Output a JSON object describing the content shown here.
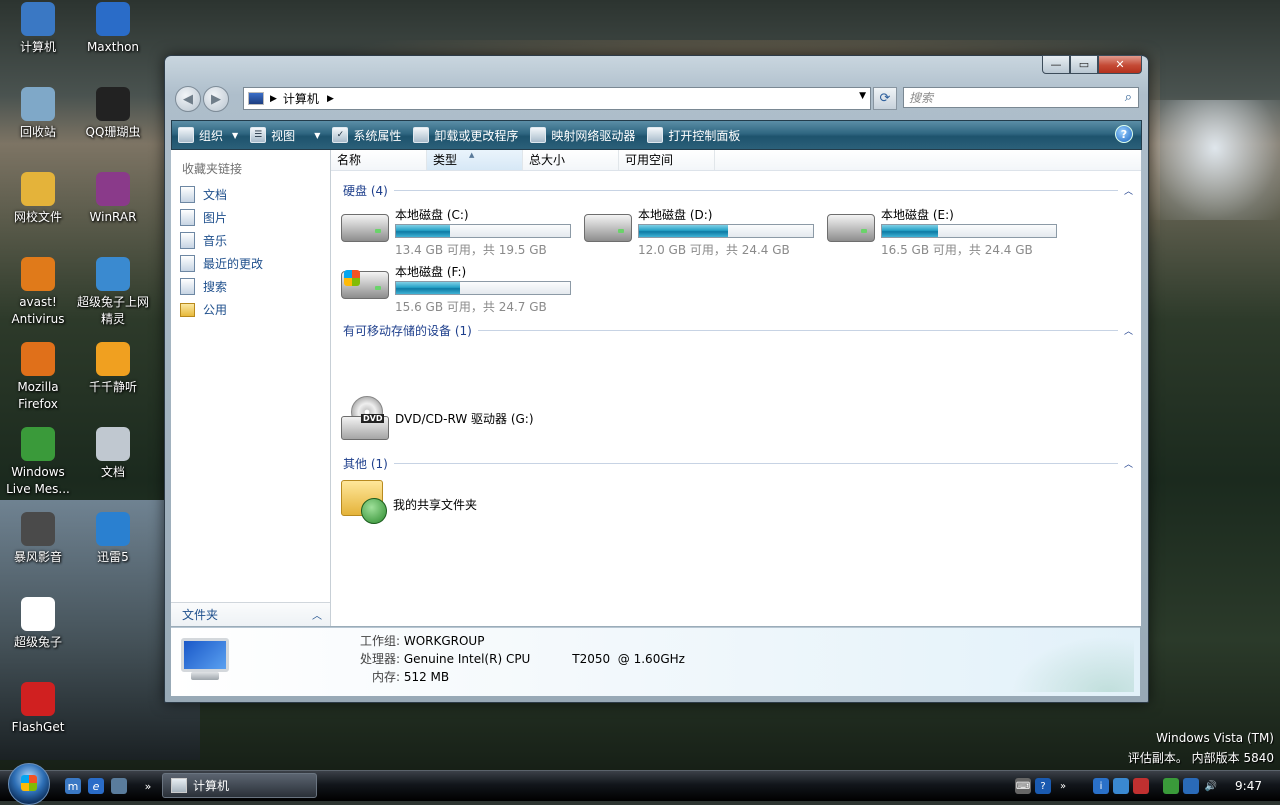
{
  "desktop": {
    "icons": [
      {
        "label": "计算机",
        "icon": "computer-icon",
        "color": "#3a78c4"
      },
      {
        "label": "Maxthon",
        "icon": "maxthon-icon",
        "color": "#2a6cc8"
      },
      {
        "label": "回收站",
        "icon": "recycle-bin-icon",
        "color": "#7fa8c8"
      },
      {
        "label": "QQ珊瑚虫",
        "icon": "qq-icon",
        "color": "#222222"
      },
      {
        "label": "网校文件",
        "icon": "folder-icon",
        "color": "#e4b33a"
      },
      {
        "label": "WinRAR",
        "icon": "winrar-icon",
        "color": "#8a3a8a"
      },
      {
        "label": "avast! Antivirus",
        "icon": "avast-icon",
        "color": "#e07a1a"
      },
      {
        "label": "超级兔子上网精灵",
        "icon": "rabbit-web-icon",
        "color": "#3a8ad0"
      },
      {
        "label": "Mozilla Firefox",
        "icon": "firefox-icon",
        "color": "#e0701a"
      },
      {
        "label": "千千静听",
        "icon": "ttplayer-icon",
        "color": "#f0a020"
      },
      {
        "label": "Windows Live Mes...",
        "icon": "messenger-icon",
        "color": "#3a9a3a"
      },
      {
        "label": "文档",
        "icon": "documents-icon",
        "color": "#c0c8d0"
      },
      {
        "label": "暴风影音",
        "icon": "storm-player-icon",
        "color": "#4a4a4a"
      },
      {
        "label": "迅雷5",
        "icon": "thunder-icon",
        "color": "#2a80d0"
      },
      {
        "label": "超级兔子",
        "icon": "rabbit-icon",
        "color": "#ffffff"
      },
      {
        "label": "FlashGet",
        "icon": "flashget-icon",
        "color": "#d02020"
      }
    ],
    "watermark_line1": "Windows Vista (TM)",
    "watermark_line2": "评估副本。 内部版本 5840"
  },
  "window": {
    "address": {
      "path": "计算机"
    },
    "search_placeholder": "搜索",
    "toolbar": {
      "organize": "组织",
      "views": "视图",
      "system_properties": "系统属性",
      "uninstall": "卸载或更改程序",
      "map_drive": "映射网络驱动器",
      "control_panel": "打开控制面板"
    },
    "nav": {
      "header": "收藏夹链接",
      "items": [
        "文档",
        "图片",
        "音乐",
        "最近的更改",
        "搜索",
        "公用"
      ],
      "folders": "文件夹"
    },
    "columns": [
      "名称",
      "类型",
      "总大小",
      "可用空间"
    ],
    "groups": {
      "hdd": "硬盘 (4)",
      "removable": "有可移动存储的设备 (1)",
      "other": "其他 (1)"
    },
    "drives": [
      {
        "name": "本地磁盘 (C:)",
        "size": "13.4 GB 可用，共 19.5 GB",
        "used_fraction": 0.31
      },
      {
        "name": "本地磁盘 (D:)",
        "size": "12.0 GB 可用，共 24.4 GB",
        "used_fraction": 0.51
      },
      {
        "name": "本地磁盘 (E:)",
        "size": "16.5 GB 可用，共 24.4 GB",
        "used_fraction": 0.32
      },
      {
        "name": "本地磁盘 (F:)",
        "size": "15.6 GB 可用，共 24.7 GB",
        "used_fraction": 0.37
      }
    ],
    "dvd": {
      "name": "DVD/CD-RW 驱动器 (G:)",
      "tag": "DVD"
    },
    "shared": {
      "name": "我的共享文件夹"
    },
    "details": {
      "workgroup_label": "工作组:",
      "workgroup": "WORKGROUP",
      "cpu_label": "处理器:",
      "cpu": "Genuine Intel(R) CPU           T2050  @ 1.60GHz",
      "memory_label": "内存:",
      "memory": "512 MB"
    }
  },
  "taskbar": {
    "window_button": "计算机",
    "clock": "9:47"
  }
}
